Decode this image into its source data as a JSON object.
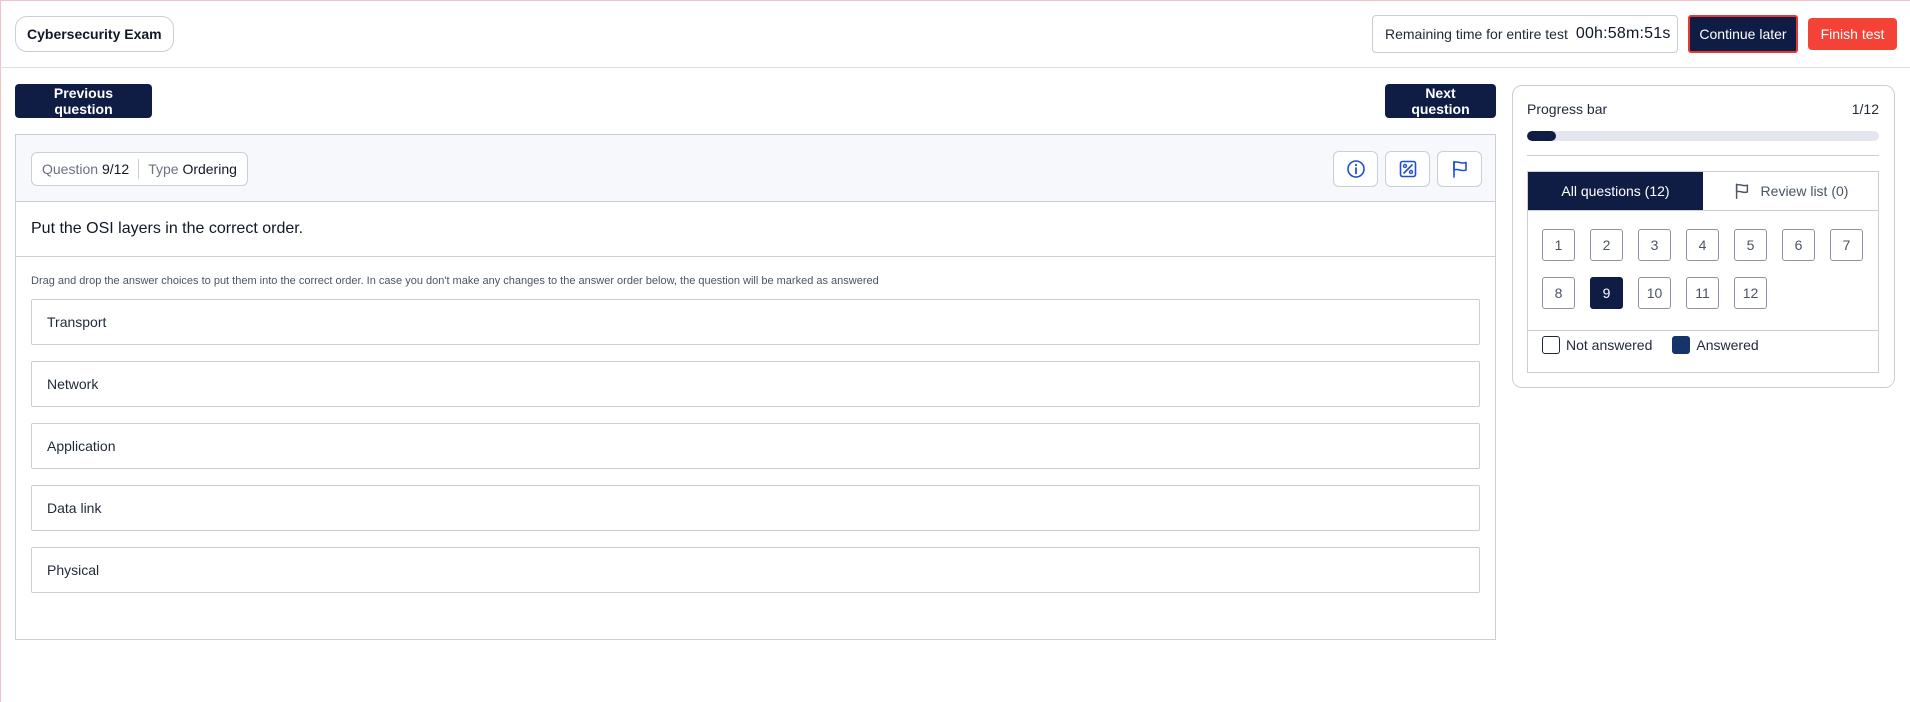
{
  "header": {
    "exam_title": "Cybersecurity Exam",
    "timer_label": "Remaining time for entire test",
    "timer_value": "00h:58m:51s",
    "continue_label": "Continue later",
    "finish_label": "Finish test"
  },
  "nav": {
    "previous_label": "Previous question",
    "next_label": "Next question"
  },
  "question": {
    "number_label": "Question",
    "number_value": "9/12",
    "type_label": "Type",
    "type_value": "Ordering",
    "text": "Put the OSI layers in the correct order.",
    "instructions": "Drag and drop the answer choices to put them into the correct order. In case you don't make any changes to the answer order below, the question will be marked as answered",
    "icons": [
      "info-icon",
      "image-icon",
      "flag-icon"
    ],
    "answers": [
      "Transport",
      "Network",
      "Application",
      "Data link",
      "Physical"
    ]
  },
  "progress": {
    "label": "Progress bar",
    "count": "1/12",
    "fraction": 0.0833
  },
  "navigator": {
    "tab_all": "All questions (12)",
    "tab_review": "Review list (0)",
    "numbers": [
      "1",
      "2",
      "3",
      "4",
      "5",
      "6",
      "7",
      "8",
      "9",
      "10",
      "11",
      "12"
    ],
    "current": "9",
    "legend_not_answered": "Not answered",
    "legend_answered": "Answered"
  },
  "colors": {
    "primary": "#0f1d45",
    "finish": "#f44336",
    "answered": "#14346b"
  }
}
